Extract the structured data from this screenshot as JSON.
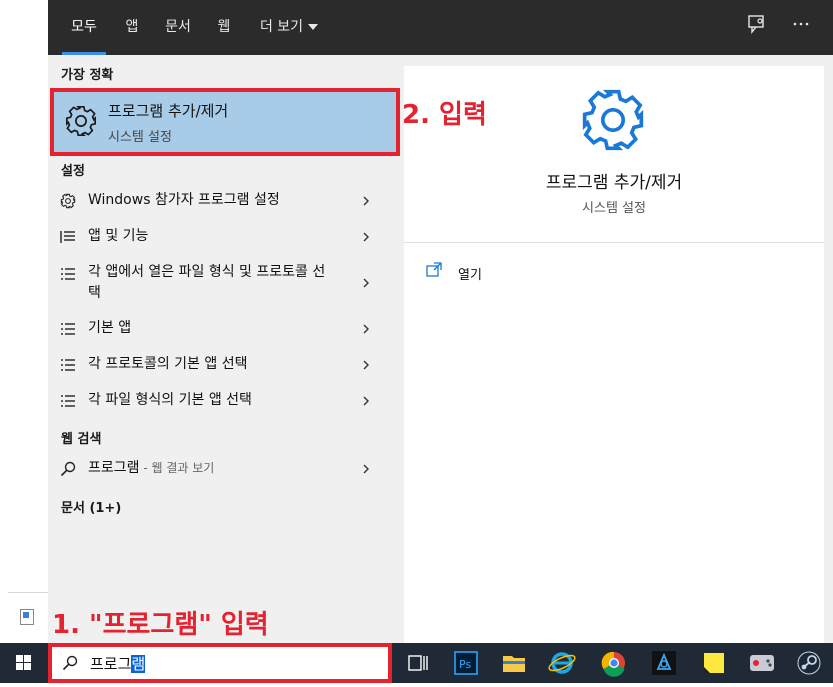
{
  "tabs": [
    {
      "label": "모두",
      "active": true
    },
    {
      "label": "앱"
    },
    {
      "label": "문서"
    },
    {
      "label": "웹"
    },
    {
      "label": "더 보기"
    }
  ],
  "sections": {
    "best_match": "가장 정확",
    "settings": "설정",
    "web_search": "웹 검색",
    "documents": "문서 (1+)"
  },
  "best_match": {
    "title": "프로그램 추가/제거",
    "subtitle": "시스템 설정"
  },
  "settings_items": [
    {
      "label": "Windows 참가자 프로그램 설정",
      "icon": "gear-icon"
    },
    {
      "label": "앱 및 기능",
      "icon": "list-icon"
    },
    {
      "label": "각 앱에서 열은 파일 형식 및 프로토콜 선택",
      "icon": "list-icon"
    },
    {
      "label": "기본 앱",
      "icon": "list-icon"
    },
    {
      "label": "각 프로토콜의 기본 앱 선택",
      "icon": "list-icon"
    },
    {
      "label": "각 파일 형식의 기본 앱 선택",
      "icon": "list-icon"
    }
  ],
  "web_item": {
    "label": "프로그램",
    "sub": " - 웹 결과 보기"
  },
  "preview": {
    "title": "프로그램 추가/제거",
    "subtitle": "시스템 설정",
    "open_label": "열기"
  },
  "annotations": {
    "step1": "1. \"프로그램\" 입력",
    "step2": "2. 입력"
  },
  "search": {
    "typed": "프로그",
    "selected": "램"
  },
  "colors": {
    "accent": "#3a8ee6",
    "annotation": "#e52330",
    "highlight": "#a8cce8",
    "gear": "#1a78d6"
  }
}
